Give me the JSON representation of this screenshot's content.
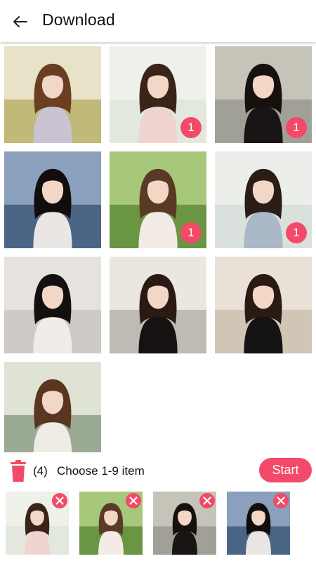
{
  "header": {
    "title": "Download",
    "back_icon": "arrow-left-icon"
  },
  "grid": {
    "photos": [
      {
        "badge": null,
        "colors": {
          "bg": "#b8b26a",
          "bg2": "#e8e2c8",
          "hair": "#6a3e22",
          "cloth": "#c9c3d2"
        }
      },
      {
        "badge": "1",
        "colors": {
          "bg": "#dfe6dc",
          "bg2": "#eef1ea",
          "hair": "#3a2418",
          "cloth": "#f0d4d0"
        }
      },
      {
        "badge": "1",
        "colors": {
          "bg": "#9a9a92",
          "bg2": "#c6c4b8",
          "hair": "#17110e",
          "cloth": "#1a1515"
        }
      },
      {
        "badge": null,
        "colors": {
          "bg": "#3f5a7e",
          "bg2": "#8aa0bd",
          "hair": "#120c0c",
          "cloth": "#e9e6e4"
        }
      },
      {
        "badge": "1",
        "colors": {
          "bg": "#5f8c3a",
          "bg2": "#a7c77a",
          "hair": "#5a3a25",
          "cloth": "#f3ece6"
        }
      },
      {
        "badge": "1",
        "colors": {
          "bg": "#d7ddd8",
          "bg2": "#eceeea",
          "hair": "#2a1d18",
          "cloth": "#aab8c8"
        }
      },
      {
        "badge": null,
        "colors": {
          "bg": "#c8c6c4",
          "bg2": "#e6e2de",
          "hair": "#141010",
          "cloth": "#f0ece8"
        }
      },
      {
        "badge": null,
        "colors": {
          "bg": "#b6b3ad",
          "bg2": "#ebe7e0",
          "hair": "#2a1a14",
          "cloth": "#161212"
        }
      },
      {
        "badge": null,
        "colors": {
          "bg": "#cdbfb0",
          "bg2": "#e9e1d8",
          "hair": "#2a1a14",
          "cloth": "#141212"
        }
      },
      {
        "badge": null,
        "colors": {
          "bg": "#8ea088",
          "bg2": "#dfe3d6",
          "hair": "#5a3520",
          "cloth": "#efece6"
        }
      }
    ]
  },
  "selection": {
    "trash_icon": "trash-icon",
    "count": "(4)",
    "hint": "Choose 1-9 item",
    "start_label": "Start"
  },
  "tray": {
    "remove_icon": "close-icon",
    "items": [
      {
        "colors": {
          "bg": "#dfe6dc",
          "bg2": "#eef1ea",
          "hair": "#3a2418",
          "cloth": "#f0d4d0"
        }
      },
      {
        "colors": {
          "bg": "#5f8c3a",
          "bg2": "#a7c77a",
          "hair": "#5a3a25",
          "cloth": "#f3ece6"
        }
      },
      {
        "colors": {
          "bg": "#9a9a92",
          "bg2": "#c6c4b8",
          "hair": "#17110e",
          "cloth": "#1a1515"
        }
      },
      {
        "colors": {
          "bg": "#3f5a7e",
          "bg2": "#8aa0bd",
          "hair": "#120c0c",
          "cloth": "#e9e6e4"
        }
      }
    ]
  },
  "accent_color": "#f24a68"
}
